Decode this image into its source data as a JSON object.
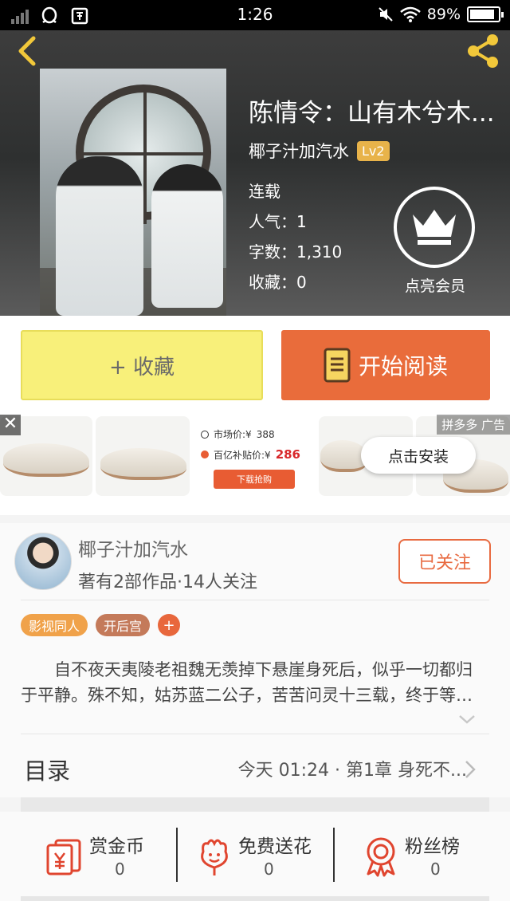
{
  "status_bar": {
    "time": "1:26",
    "battery": "89%",
    "battery_level": 0.89
  },
  "book": {
    "title": "陈情令：山有木兮木...",
    "author": "椰子汁加汽水",
    "level": "Lv2",
    "status": "连载",
    "popularity": "人气：1",
    "word_count": "字数：1,310",
    "favorites": "收藏：0"
  },
  "vip": {
    "label": "点亮会员"
  },
  "actions": {
    "collect": "+ 收藏",
    "read": "开始阅读"
  },
  "ad": {
    "market_price_label": "市场价:¥",
    "market_price": "388",
    "subsidy_price_label": "百亿补贴价:¥",
    "subsidy_price": "286",
    "download_button": "下载抢购",
    "sponsor": "拼多多",
    "ad_label": "广告",
    "install_button": "点击安装",
    "close": "✕"
  },
  "author_card": {
    "name": "椰子汁加汽水",
    "stats": "著有2部作品·14人关注",
    "follow_button": "已关注",
    "tags": [
      {
        "label": "影视同人",
        "color": "#f0a24a"
      },
      {
        "label": "开后宫",
        "color": "#c47a5a"
      }
    ],
    "tag_add": "+"
  },
  "synopsis": "自不夜天夷陵老祖魏无羡掉下悬崖身死后，似乎一切都归于平静。殊不知，姑苏蓝二公子，苦苦问灵十三载，终于等到了他的归来……",
  "toc": {
    "label": "目录",
    "latest": "今天 01:24 · 第1章  身死不..."
  },
  "features": [
    {
      "label": "赏金币",
      "count": "0",
      "icon": "reward-coin-icon"
    },
    {
      "label": "免费送花",
      "count": "0",
      "icon": "flower-icon"
    },
    {
      "label": "粉丝榜",
      "count": "0",
      "icon": "medal-icon"
    }
  ],
  "colors": {
    "accent": "#e96c3b",
    "collect_bg": "#f8f07a",
    "icon_red": "#e0452f"
  }
}
